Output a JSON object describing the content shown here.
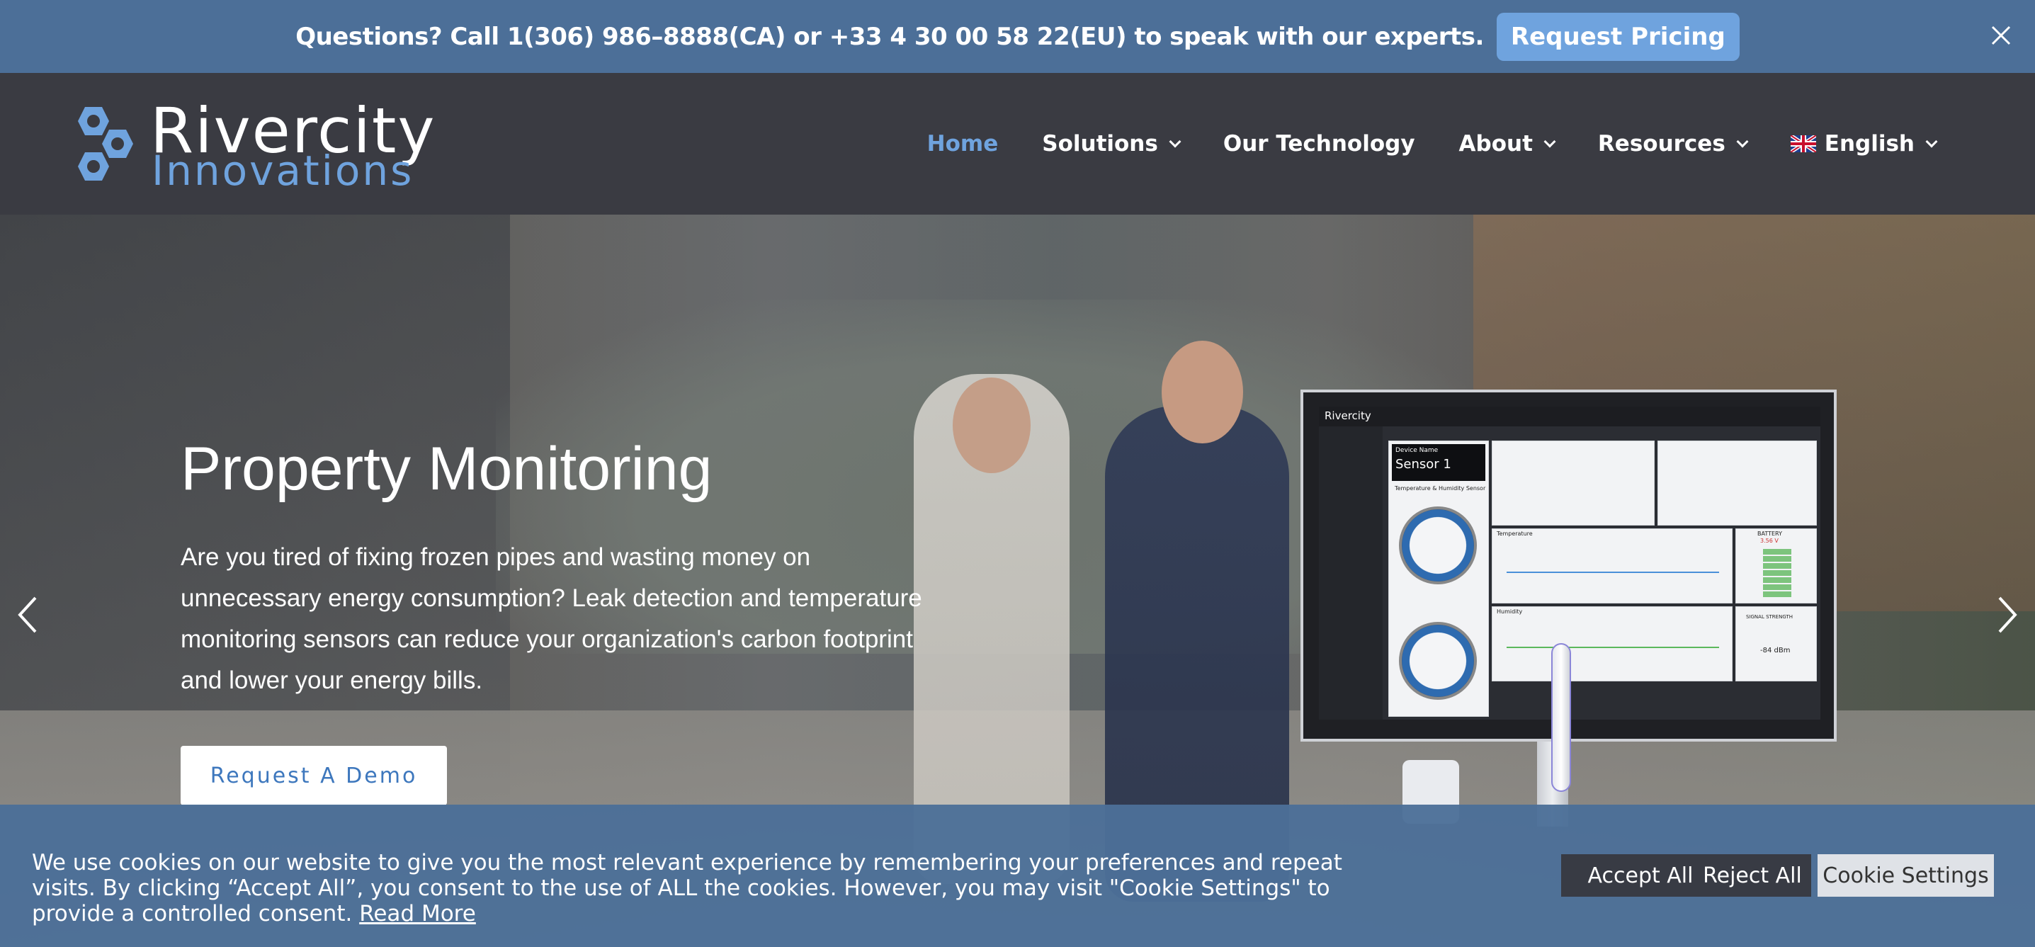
{
  "topbar": {
    "message": "Questions? Call 1(306) 986–8888(CA) or +33 4 30 00 58 22(EU) to speak with our experts.",
    "cta_label": "Request Pricing",
    "close_icon": "close-icon"
  },
  "header": {
    "logo": {
      "line1": "Rivercity",
      "line2": "Innovations"
    },
    "nav": [
      {
        "label": "Home",
        "active": true
      },
      {
        "label": "Solutions",
        "dropdown": true
      },
      {
        "label": "Our Technology"
      },
      {
        "label": "About",
        "dropdown": true
      },
      {
        "label": "Resources",
        "dropdown": true
      },
      {
        "label": "English",
        "dropdown": true,
        "icon": "uk-flag-icon"
      }
    ]
  },
  "hero": {
    "title": "Property Monitoring",
    "description": "Are you tired of fixing frozen pipes and wasting money on unnecessary energy consumption? Leak detection and temperature monitoring sensors can reduce your organization's carbon footprint and lower your energy bills.",
    "cta_label": "Request A Demo",
    "prev_icon": "chevron-left-icon",
    "next_icon": "chevron-right-icon",
    "dashboard": {
      "brand": "Rivercity",
      "device_name_label": "Device Name",
      "device_name": "Sensor 1",
      "sensor_type": "Temperature & Humidity Sensor",
      "panel_temperature": "Temperature",
      "panel_humidity": "Humidity",
      "battery_label": "BATTERY",
      "battery_value": "3.56 V",
      "signal_label": "SIGNAL STRENGTH",
      "signal_value": "-84 dBm"
    }
  },
  "cookie": {
    "text": "We use cookies on our website to give you the most relevant experience by remembering your preferences and repeat visits. By clicking “Accept All”, you consent to the use of ALL the cookies. However, you may visit \"Cookie Settings\" to provide a controlled consent.",
    "read_more": "Read More",
    "accept_label": "Accept All",
    "reject_label": "Reject All",
    "settings_label": "Cookie Settings"
  },
  "colors": {
    "topbar_bg": "#4c6f98",
    "accent": "#6fa3de",
    "header_bg": "#3a3b42",
    "cta_text": "#3d77bd"
  }
}
